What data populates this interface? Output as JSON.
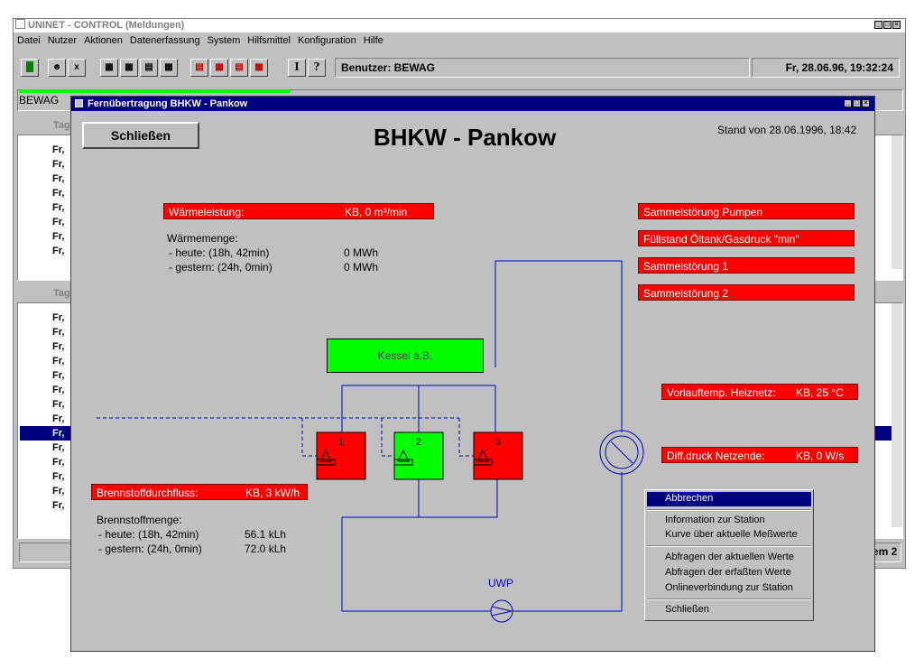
{
  "main": {
    "title": "UNINET - CONTROL (Meldungen)",
    "menu": [
      "Datei",
      "Nutzer",
      "Aktionen",
      "Datenerfassung",
      "System",
      "Hilfsmittel",
      "Konfiguration",
      "Hilfe"
    ],
    "user_label": "Benutzer: BEWAG",
    "datetime": "Fr, 28.06.96,  19:32:24",
    "tab_label": "BEWAG",
    "pane_header": "Tag",
    "row_label": "Fr,",
    "status_right": "em 2"
  },
  "popup": {
    "title": "Fernübertragung BHKW - Pankow",
    "close_button": "Schließen",
    "heading": "BHKW - Pankow",
    "stand": "Stand von 28.06.1996, 18:42",
    "waermeleistung": {
      "label": "Wärmeleistung:",
      "value": "KB, 0 m³/min"
    },
    "waermemenge": {
      "title": "Wärmemenge:",
      "heute_label": "- heute: (18h, 42min)",
      "heute_value": "0 MWh",
      "gestern_label": "- gestern: (24h, 0min)",
      "gestern_value": "0 MWh"
    },
    "alarms": [
      "Sammelstörung Pumpen",
      "Füllstand Öltank/Gasdruck \"min\"",
      "Sammelstörung 1",
      "Sammelstörung 2"
    ],
    "kessel": "Kessel a.B.",
    "boilers": [
      "1",
      "2",
      "3"
    ],
    "vorlauf": {
      "label": "Vorlauftemp. Heiznetz:",
      "value": "KB, 25 °C"
    },
    "diffdruck": {
      "label": "Diff.druck Netzende:",
      "value": "KB, 0 W/s"
    },
    "brennstoff": {
      "label": "Brennstoffdurchfluss:",
      "value": "KB, 3 kW/h"
    },
    "brennstoffmenge": {
      "title": "Brennstoffmenge:",
      "heute_label": "- heute: (18h, 42min)",
      "heute_value": "56.1 kLh",
      "gestern_label": "- gestern: (24h, 0min)",
      "gestern_value": "72.0 kLh"
    },
    "uwp": "UWP",
    "context_menu": {
      "selected": "Abbrechen",
      "group1": [
        "Information zur Station",
        "Kurve über aktuelle Meßwerte"
      ],
      "group2": [
        "Abfragen der aktuellen Werte",
        "Abfragen der erfaßten Werte",
        "Onlineverbindung zur Station"
      ],
      "group3": [
        "Schließen"
      ]
    }
  },
  "colors": {
    "alarm": "#ff0000",
    "ok": "#00ff00",
    "pipe": "#0000c0",
    "titlebar": "#000080"
  }
}
